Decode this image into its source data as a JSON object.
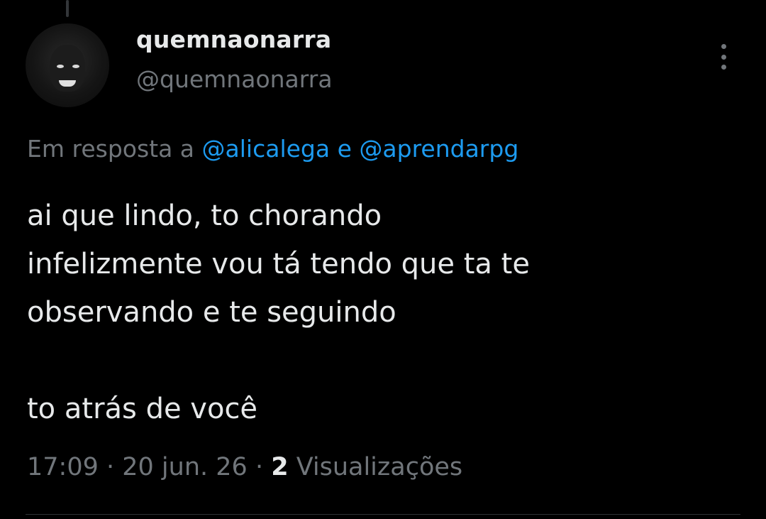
{
  "author": {
    "display_name": "quemnaonarra",
    "handle": "@quemnaonarra",
    "avatar_icon": "profile-photo"
  },
  "reply": {
    "prefix": "Em resposta a ",
    "mention_1": "@alicalega",
    "conjunction": " e ",
    "mention_2": "@aprendarpg"
  },
  "tweet": {
    "lines": [
      "ai que lindo, to chorando",
      "infelizmente vou tá tendo que ta te",
      "observando e te seguindo",
      "to atrás de você"
    ]
  },
  "meta": {
    "time": "17:09",
    "separator": " · ",
    "date": "20 jun. 26",
    "views_count": "2",
    "views_label": " Visualizações"
  },
  "colors": {
    "background": "#000000",
    "text": "#e7e9ea",
    "muted": "#71767b",
    "accent": "#1d9bf0"
  },
  "icons": {
    "more": "more-options-icon"
  }
}
